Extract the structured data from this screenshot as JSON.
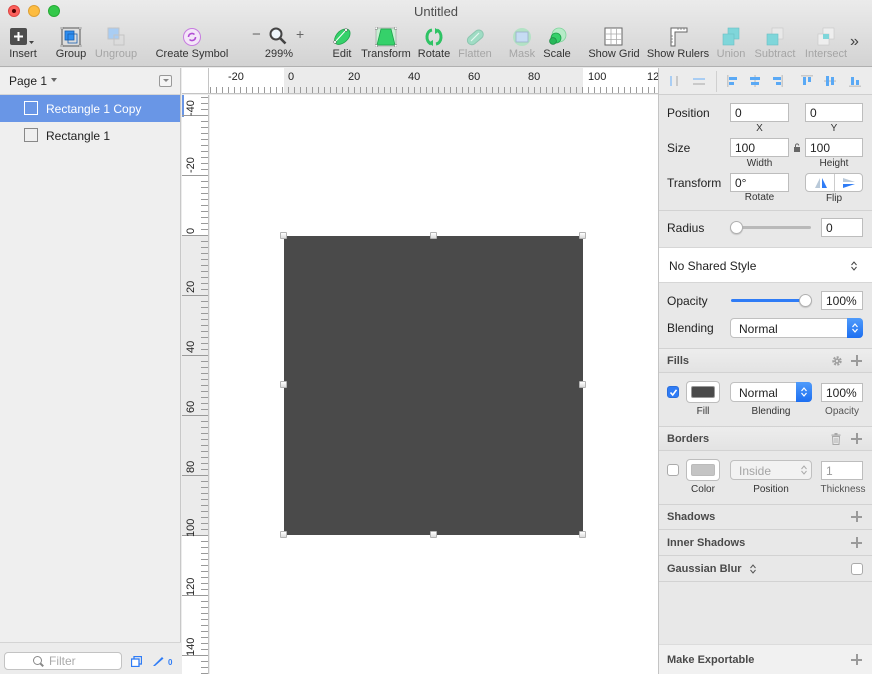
{
  "window": {
    "title": "Untitled"
  },
  "toolbar": {
    "insert": "Insert",
    "group": "Group",
    "ungroup": "Ungroup",
    "create_symbol": "Create Symbol",
    "zoom_minus": "−",
    "zoom_plus": "+",
    "zoom_level": "299%",
    "edit": "Edit",
    "transform": "Transform",
    "rotate": "Rotate",
    "flatten": "Flatten",
    "mask": "Mask",
    "scale": "Scale",
    "show_grid": "Show Grid",
    "show_rulers": "Show Rulers",
    "union": "Union",
    "subtract": "Subtract",
    "intersect": "Intersect",
    "overflow": "»"
  },
  "sidebar": {
    "page": "Page 1",
    "layers": [
      {
        "name": "Rectangle 1 Copy",
        "selected": true
      },
      {
        "name": "Rectangle 1",
        "selected": false
      }
    ],
    "filter_placeholder": "Filter",
    "slice_count": "0"
  },
  "rulers": {
    "horizontal": [
      "-20",
      "0",
      "20",
      "40",
      "60",
      "80",
      "100",
      "12"
    ],
    "vertical": [
      "-40",
      "-20",
      "0",
      "20",
      "40",
      "60",
      "80",
      "100",
      "120",
      "140"
    ]
  },
  "canvas": {
    "shape_fill": "#4a4a4a"
  },
  "inspector": {
    "position_label": "Position",
    "x_value": "0",
    "x_label": "X",
    "y_value": "0",
    "y_label": "Y",
    "size_label": "Size",
    "width_value": "100",
    "width_label": "Width",
    "height_value": "100",
    "height_label": "Height",
    "transform_label": "Transform",
    "rotate_value": "0°",
    "rotate_label": "Rotate",
    "flip_label": "Flip",
    "radius_label": "Radius",
    "radius_value": "0",
    "radius_fraction": 0,
    "shared_style": "No Shared Style",
    "opacity_label": "Opacity",
    "opacity_value": "100%",
    "opacity_fraction": 1,
    "blending_label": "Blending",
    "blending_value": "Normal",
    "fills": {
      "title": "Fills",
      "enabled": true,
      "color": "#4a4a4a",
      "fill_label": "Fill",
      "blending_value": "Normal",
      "blending_label": "Blending",
      "opacity_value": "100%",
      "opacity_label": "Opacity"
    },
    "borders": {
      "title": "Borders",
      "enabled": false,
      "color": "#c4c4c4",
      "color_label": "Color",
      "position_value": "Inside",
      "position_label": "Position",
      "thickness_value": "1",
      "thickness_label": "Thickness"
    },
    "shadows_title": "Shadows",
    "inner_shadows_title": "Inner Shadows",
    "gaussian_blur_title": "Gaussian Blur",
    "make_exportable": "Make Exportable"
  },
  "colors": {
    "accent": "#2f7cf6",
    "selection": "#6996e6",
    "tool_green": "#2ecc71"
  }
}
